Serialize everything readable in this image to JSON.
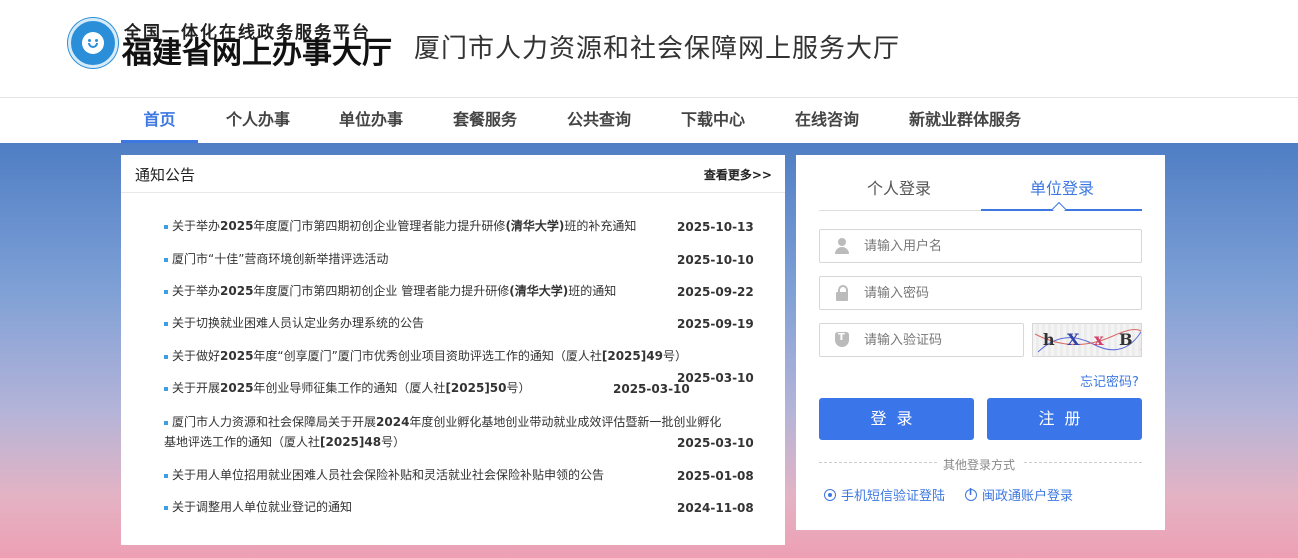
{
  "header": {
    "logo_line1": "全国一体化在线政务服务平台",
    "logo_line2": "福建省网上办事大厅",
    "site_title": "厦门市人力资源和社会保障网上服务大厅",
    "logo_icon": "smiley-emblem-icon"
  },
  "nav": {
    "items": [
      "首页",
      "个人办事",
      "单位办事",
      "套餐服务",
      "公共查询",
      "下载中心",
      "在线咨询",
      "新就业群体服务"
    ],
    "active_index": 0,
    "accent": "#3d78e0"
  },
  "notice": {
    "title": "通知公告",
    "more": "查看更多>>",
    "items": [
      {
        "title_parts": [
          "关于举办",
          "2025",
          "年度厦门市第四期初创企业管理者能力提升研修",
          "(清华大学)",
          "班的补充通知"
        ],
        "date": "2025-10-13"
      },
      {
        "title": "厦门市“十佳”营商环境创新举措评选活动",
        "date": "2025-10-10"
      },
      {
        "title_parts": [
          "关于举办",
          "2025",
          "年度厦门市第四期初创企业 管理者能力提升研修",
          "(清华大学)",
          "班的通知"
        ],
        "date": "2025-09-22"
      },
      {
        "title": "关于切换就业困难人员认定业务办理系统的公告",
        "date": "2025-09-19"
      },
      {
        "title_parts": [
          "关于做好",
          "2025",
          "年度“创享厦门”厦门市优秀创业项目资助评选工作的通知（厦人社",
          "[2025]49",
          "号）"
        ],
        "date": "2025-03-10"
      },
      {
        "title_parts": [
          "关于开展",
          "2025",
          "年创业导师征集工作的通知（厦人社",
          "[2025]50",
          "号）"
        ],
        "date": "2025-03-10"
      },
      {
        "title_parts": [
          "厦门市人力资源和社会保障局关于开展",
          "2024",
          "年度创业孵化基地创业带动就业成效评估暨新一批创业孵化"
        ],
        "title_line2_parts": [
          "基地评选工作的通知（厦人社",
          "[2025]48",
          "号）"
        ],
        "date": "2025-03-10"
      },
      {
        "title": "关于用人单位招用就业困难人员社会保险补贴和灵活就业社会保险补贴申领的公告",
        "date": "2025-01-08"
      },
      {
        "title": "关于调整用人单位就业登记的通知",
        "date": "2024-11-08"
      }
    ]
  },
  "login": {
    "tabs": [
      "个人登录",
      "单位登录"
    ],
    "active_tab": 1,
    "username_placeholder": "请输入用户名",
    "password_placeholder": "请输入密码",
    "captcha_placeholder": "请输入验证码",
    "captcha_chars": [
      "h",
      "X",
      "x",
      "B"
    ],
    "forgot": "忘记密码?",
    "login_button": "登录",
    "register_button": "注册",
    "other_methods": "其他登录方式",
    "sms_login": "手机短信验证登陆",
    "mzt_login": "闽政通账户登录",
    "button_color": "#3a76ea"
  }
}
